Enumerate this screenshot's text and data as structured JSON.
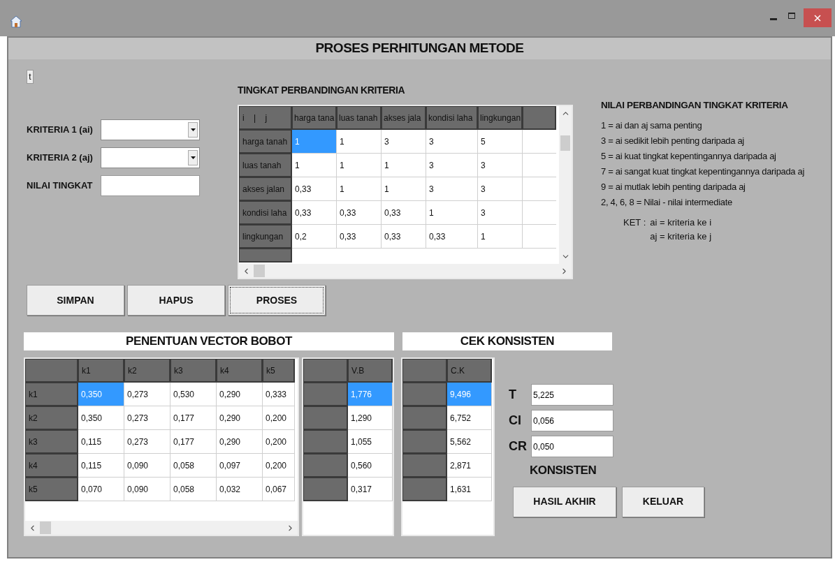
{
  "window": {
    "title": "PROSES PERHITUNGAN METODE"
  },
  "small_button": "t",
  "form": {
    "fields": [
      {
        "label": "KRITERIA 1 (ai)",
        "kind": "dropdown"
      },
      {
        "label": "KRITERIA 2 (aj)",
        "kind": "dropdown"
      },
      {
        "label": "NILAI TINGKAT",
        "kind": "text"
      }
    ]
  },
  "comparison": {
    "title": "TINGKAT PERBANDINGAN KRITERIA",
    "corner": "i    |    j",
    "columns": [
      "harga tana",
      "luas tanah",
      "akses jala",
      "kondisi laha",
      "lingkungan"
    ],
    "rows": [
      {
        "header": "harga tanah",
        "cells": [
          {
            "text": "1",
            "selected": true
          },
          {
            "text": "1",
            "selected": false
          },
          {
            "text": "3",
            "selected": false
          },
          {
            "text": "3",
            "selected": false
          },
          {
            "text": "5",
            "selected": false
          }
        ]
      },
      {
        "header": "luas tanah",
        "cells": [
          {
            "text": "1",
            "selected": false
          },
          {
            "text": "1",
            "selected": false
          },
          {
            "text": "1",
            "selected": false
          },
          {
            "text": "3",
            "selected": false
          },
          {
            "text": "3",
            "selected": false
          }
        ]
      },
      {
        "header": "akses jalan",
        "cells": [
          {
            "text": "0,33",
            "selected": false
          },
          {
            "text": "1",
            "selected": false
          },
          {
            "text": "1",
            "selected": false
          },
          {
            "text": "3",
            "selected": false
          },
          {
            "text": "3",
            "selected": false
          }
        ]
      },
      {
        "header": "kondisi laha",
        "cells": [
          {
            "text": "0,33",
            "selected": false
          },
          {
            "text": "0,33",
            "selected": false
          },
          {
            "text": "0,33",
            "selected": false
          },
          {
            "text": "1",
            "selected": false
          },
          {
            "text": "3",
            "selected": false
          }
        ]
      },
      {
        "header": "lingkungan",
        "cells": [
          {
            "text": "0,2",
            "selected": false
          },
          {
            "text": "0,33",
            "selected": false
          },
          {
            "text": "0,33",
            "selected": false
          },
          {
            "text": "0,33",
            "selected": false
          },
          {
            "text": "1",
            "selected": false
          }
        ]
      }
    ]
  },
  "legend": {
    "title": "NILAI PERBANDINGAN TINGKAT KRITERIA",
    "lines": [
      "1 = ai dan aj sama penting",
      "3 = ai sedikit lebih penting daripada aj",
      "5 = ai kuat tingkat kepentingannya daripada aj",
      "7 = ai sangat kuat tingkat kepentingannya daripada aj",
      "9 = ai mutlak lebih penting daripada aj",
      "2, 4, 6, 8 = Nilai - nilai intermediate"
    ],
    "ket_label": "KET :",
    "ket_lines": [
      "ai = kriteria ke i",
      "aj = kriteria ke j"
    ]
  },
  "actions": [
    "SIMPAN",
    "HAPUS",
    "PROSES"
  ],
  "vector": {
    "title": "PENENTUAN VECTOR BOBOT",
    "columns": [
      "k1",
      "k2",
      "k3",
      "k4",
      "k5"
    ],
    "rows": [
      {
        "header": "k1",
        "cells": [
          {
            "text": "0,350",
            "selected": true
          },
          {
            "text": "0,273",
            "selected": false
          },
          {
            "text": "0,530",
            "selected": false
          },
          {
            "text": "0,290",
            "selected": false
          },
          {
            "text": "0,333",
            "selected": false
          }
        ]
      },
      {
        "header": "k2",
        "cells": [
          {
            "text": "0,350",
            "selected": false
          },
          {
            "text": "0,273",
            "selected": false
          },
          {
            "text": "0,177",
            "selected": false
          },
          {
            "text": "0,290",
            "selected": false
          },
          {
            "text": "0,200",
            "selected": false
          }
        ]
      },
      {
        "header": "k3",
        "cells": [
          {
            "text": "0,115",
            "selected": false
          },
          {
            "text": "0,273",
            "selected": false
          },
          {
            "text": "0,177",
            "selected": false
          },
          {
            "text": "0,290",
            "selected": false
          },
          {
            "text": "0,200",
            "selected": false
          }
        ]
      },
      {
        "header": "k4",
        "cells": [
          {
            "text": "0,115",
            "selected": false
          },
          {
            "text": "0,090",
            "selected": false
          },
          {
            "text": "0,058",
            "selected": false
          },
          {
            "text": "0,097",
            "selected": false
          },
          {
            "text": "0,200",
            "selected": false
          }
        ]
      },
      {
        "header": "k5",
        "cells": [
          {
            "text": "0,070",
            "selected": false
          },
          {
            "text": "0,090",
            "selected": false
          },
          {
            "text": "0,058",
            "selected": false
          },
          {
            "text": "0,032",
            "selected": false
          },
          {
            "text": "0,067",
            "selected": false
          }
        ]
      }
    ]
  },
  "vb": {
    "column": "V.B",
    "cells": [
      {
        "text": "1,776",
        "selected": true
      },
      {
        "text": "1,290",
        "selected": false
      },
      {
        "text": "1,055",
        "selected": false
      },
      {
        "text": "0,560",
        "selected": false
      },
      {
        "text": "0,317",
        "selected": false
      }
    ]
  },
  "consistency": {
    "title": "CEK KONSISTEN",
    "column": "C.K",
    "cells": [
      {
        "text": "9,496",
        "selected": true
      },
      {
        "text": "6,752",
        "selected": false
      },
      {
        "text": "5,562",
        "selected": false
      },
      {
        "text": "2,871",
        "selected": false
      },
      {
        "text": "1,631",
        "selected": false
      }
    ],
    "values": [
      {
        "label": "T",
        "value": "5,225"
      },
      {
        "label": "CI",
        "value": "0,056"
      },
      {
        "label": "CR",
        "value": "0,050"
      }
    ],
    "status": "KONSISTEN",
    "buttons": [
      "HASIL AKHIR",
      "KELUAR"
    ]
  }
}
